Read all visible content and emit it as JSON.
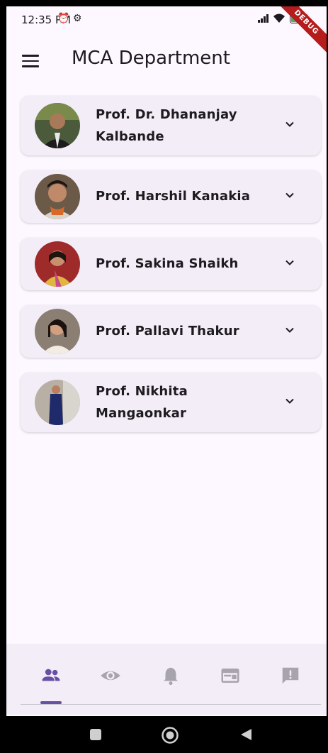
{
  "status_bar": {
    "time": "12:35 PM",
    "status_icons": "⏰ ⚙",
    "debug_banner": "DEBUG"
  },
  "app_bar": {
    "title": "MCA Department",
    "menu_icon": "menu-icon"
  },
  "faculty": [
    {
      "line1": "Prof. Dr. Dhananjay",
      "line2": "Kalbande",
      "avatar_bg": "#4a5a3a"
    },
    {
      "line1": "Prof. Harshil Kanakia",
      "line2": "",
      "avatar_bg": "#6b5a48"
    },
    {
      "line1": "Prof. Sakina Shaikh",
      "line2": "",
      "avatar_bg": "#9e2a2a"
    },
    {
      "line1": "Prof. Pallavi Thakur",
      "line2": "",
      "avatar_bg": "#8a7f72"
    },
    {
      "line1": "Prof. Nikhita",
      "line2": "Mangaonkar",
      "avatar_bg": "#b8b0a4"
    }
  ],
  "bottom_nav": {
    "items": [
      "people-icon",
      "eye-icon",
      "bell-icon",
      "card-icon",
      "feedback-icon"
    ],
    "selected_index": 0,
    "active_color": "#6750a4",
    "inactive_color": "#a8a4ad"
  },
  "system_nav": [
    "recents-icon",
    "home-icon",
    "back-icon"
  ]
}
